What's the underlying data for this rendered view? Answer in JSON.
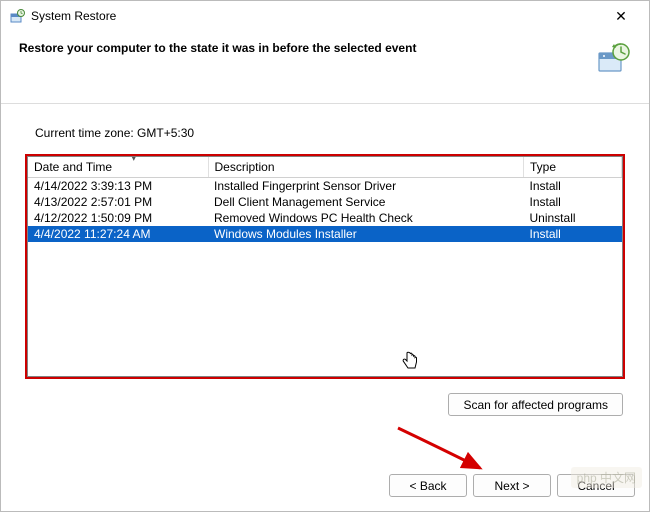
{
  "window": {
    "title": "System Restore",
    "close_label": "✕"
  },
  "header": {
    "text": "Restore your computer to the state it was in before the selected event"
  },
  "content": {
    "timezone": "Current time zone: GMT+5:30"
  },
  "table": {
    "columns": {
      "datetime": "Date and Time",
      "description": "Description",
      "type": "Type"
    },
    "rows": [
      {
        "datetime": "4/14/2022 3:39:13 PM",
        "description": "Installed Fingerprint Sensor Driver",
        "type": "Install",
        "selected": false
      },
      {
        "datetime": "4/13/2022 2:57:01 PM",
        "description": "Dell Client Management Service",
        "type": "Install",
        "selected": false
      },
      {
        "datetime": "4/12/2022 1:50:09 PM",
        "description": "Removed Windows PC Health Check",
        "type": "Uninstall",
        "selected": false
      },
      {
        "datetime": "4/4/2022 11:27:24 AM",
        "description": "Windows Modules Installer",
        "type": "Install",
        "selected": true
      }
    ]
  },
  "buttons": {
    "scan": "Scan for affected programs",
    "back": "< Back",
    "next": "Next >",
    "cancel": "Cancel"
  },
  "watermark": "php 中文网"
}
